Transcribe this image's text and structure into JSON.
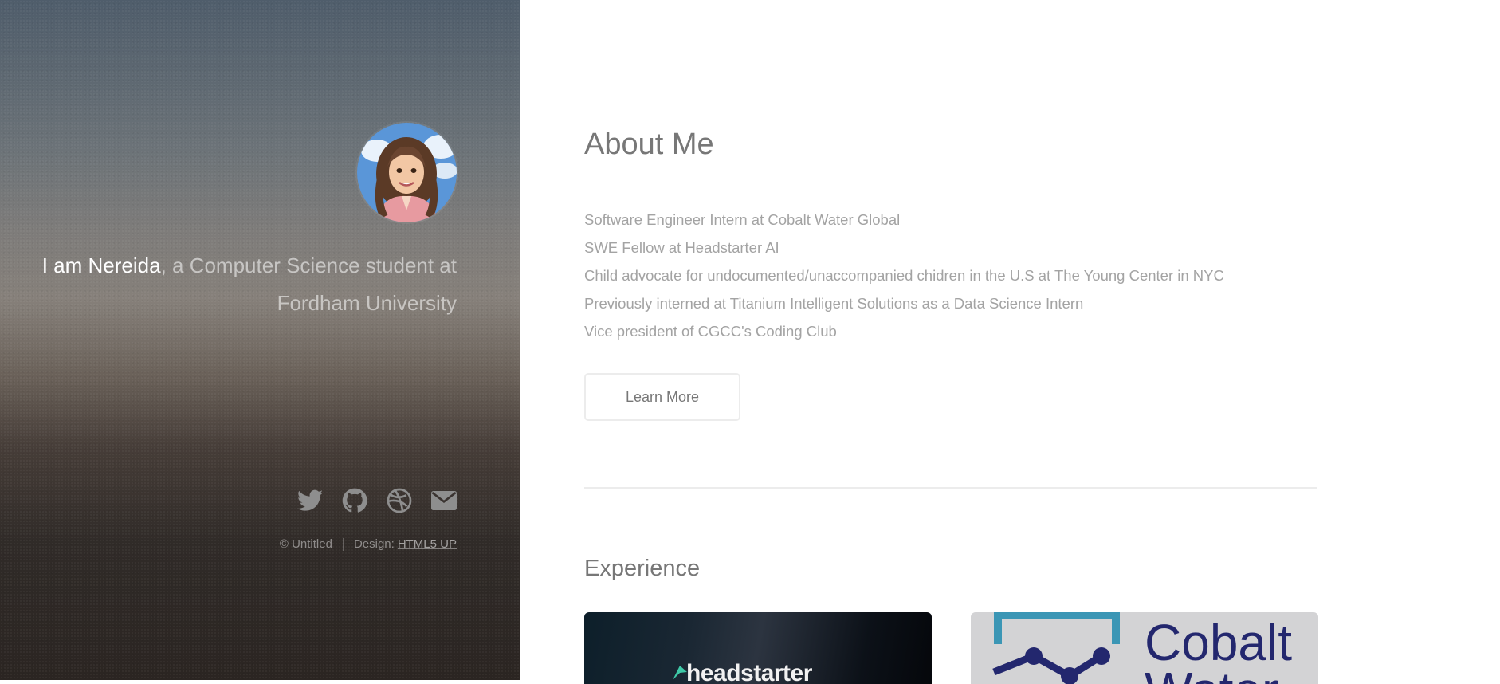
{
  "header": {
    "avatar_alt": "avatar",
    "intro_name": "I am Nereida",
    "intro_rest": ", a Computer Science student at Fordham University",
    "socials": [
      {
        "icon": "twitter-icon",
        "label": "Twitter"
      },
      {
        "icon": "github-icon",
        "label": "Github"
      },
      {
        "icon": "dribbble-icon",
        "label": "Dribbble"
      },
      {
        "icon": "email-icon",
        "label": "Email"
      }
    ],
    "copyright": "© Untitled",
    "design_label": "Design:",
    "design_link": "HTML5 UP"
  },
  "main": {
    "about_title": "About Me",
    "about_items": [
      "Software Engineer Intern at Cobalt Water Global",
      "SWE Fellow at Headstarter AI",
      "Child advocate for undocumented/unaccompanied chidren in the U.S at The Young Center in NYC",
      "Previously interned at Titanium Intelligent Solutions as a Data Science Intern",
      "Vice president of CGCC's Coding Club"
    ],
    "learn_more": "Learn More",
    "experience_title": "Experience",
    "cards": [
      {
        "label": "headstarter"
      },
      {
        "label": "Cobalt\nWater"
      }
    ]
  },
  "colors": {
    "text_muted": "#a3a3a3",
    "heading": "#777777",
    "border": "#ececec",
    "cobalt_navy": "#23276e",
    "cobalt_teal": "#3b96b5",
    "headstarter_green": "#3ec9a7"
  }
}
